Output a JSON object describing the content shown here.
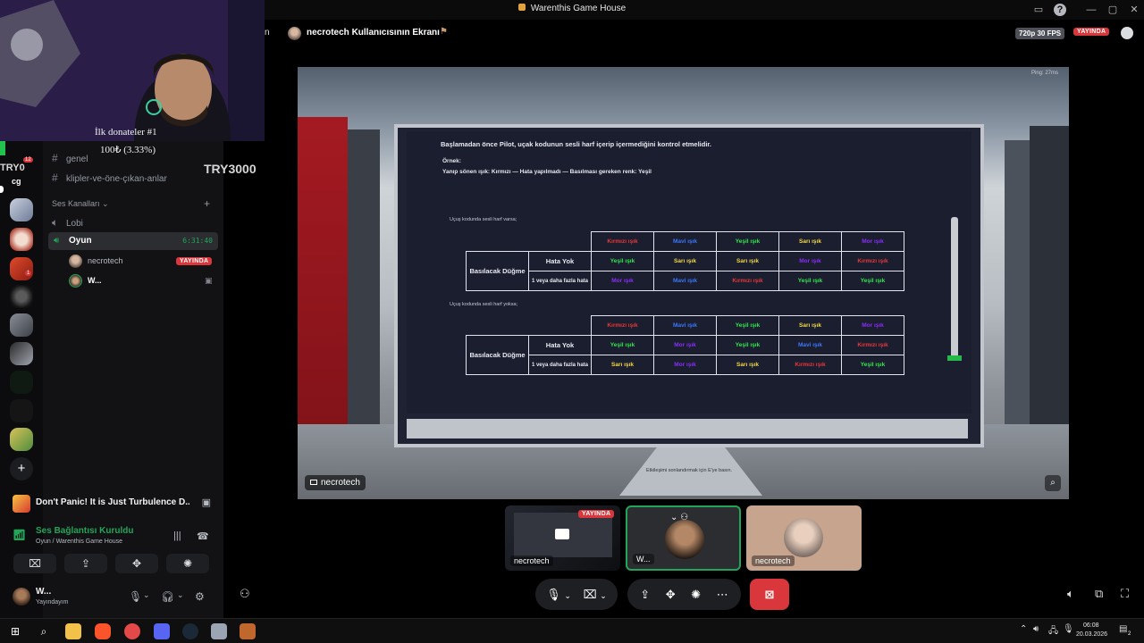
{
  "window": {
    "title": "Warenthis Game House"
  },
  "webcam": {
    "donor_label": "İlk donateler #1",
    "donor_amount": "100₺ (3.33%)",
    "ticker_left": "TRY0",
    "ticker_right": "TRY3000"
  },
  "rail": {
    "server_cg": "cg",
    "mention_count": "12",
    "unread_count": "1"
  },
  "sidebar": {
    "fragment_genel": "genel",
    "text_channel": "klipler-ve-öne-çıkan-anlar",
    "voice_category": "Ses Kanalları",
    "voice_channels": [
      "Lobi",
      "Oyun"
    ],
    "voice_time": "6:31:40",
    "voice_users": [
      {
        "name": "necrotech",
        "badge": "YAYINDA"
      },
      {
        "name": "W..."
      }
    ]
  },
  "activity": {
    "title": "Don't Panic! It is Just Turbulence D..."
  },
  "connection": {
    "status": "Ses Bağlantısı Kuruldu",
    "location": "Oyun / Warenthis Game House"
  },
  "user": {
    "name": "W...",
    "status": "Yayındayım"
  },
  "stream": {
    "frag": "n",
    "title": "necrotech Kullanıcısının Ekranı",
    "quality": "720p 30 FPS",
    "live_badge": "YAYINDA",
    "ping": "Ping: 27ms",
    "label": "necrotech",
    "board": {
      "line1": "Başlamadan önce Pilot, uçak kodunun sesli harf içerip içermediğini kontrol etmelidir.",
      "line2": "Örnek:",
      "line3": "Yanıp sönen ışık: Kırmızı — Hata yapılmadı — Basılması gereken renk: Yeşil",
      "note1": "Uçuş kodunda sesli harf varsa;",
      "note2": "Uçuş kodunda sesli harf yoksa;",
      "press_label": "Basılacak Düğme",
      "row_ok": "Hata Yok",
      "row_err": "1 veya daha fazla hata",
      "table1": {
        "header": [
          "Kırmızı ışık",
          "Mavi ışık",
          "Yeşil ışık",
          "Sarı ışık",
          "Mor ışık"
        ],
        "ok": [
          "Yeşil ışık",
          "Sarı ışık",
          "Sarı ışık",
          "Mor ışık",
          "Kırmızı ışık"
        ],
        "err": [
          "Mor ışık",
          "Mavi ışık",
          "Kırmızı ışık",
          "Yeşil ışık",
          "Yeşil ışık"
        ]
      },
      "table2": {
        "header": [
          "Kırmızı ışık",
          "Mavi ışık",
          "Yeşil ışık",
          "Sarı ışık",
          "Mor ışık"
        ],
        "ok": [
          "Yeşil ışık",
          "Mor ışık",
          "Yeşil ışık",
          "Mavi ışık",
          "Kırmızı ışık"
        ],
        "err": [
          "Sarı ışık",
          "Mor ışık",
          "Sarı ışık",
          "Kırmızı ışık",
          "Yeşil ışık"
        ]
      },
      "caption": "Etkileşimi sonlandırmak için E'ye basın."
    }
  },
  "tiles": [
    {
      "label": "necrotech",
      "badge": "YAYINDA"
    },
    {
      "label": "W..."
    },
    {
      "label": "necrotech"
    }
  ],
  "taskbar": {
    "time": "06:08",
    "date": "20.03.2026",
    "notif": "2"
  },
  "colors": {
    "red": "#e8383a",
    "blue": "#3a78ff",
    "green": "#35e64f",
    "yellow": "#f4d84a",
    "purple": "#8b2cff",
    "discord_green": "#23a559",
    "live_red": "#da373c"
  }
}
